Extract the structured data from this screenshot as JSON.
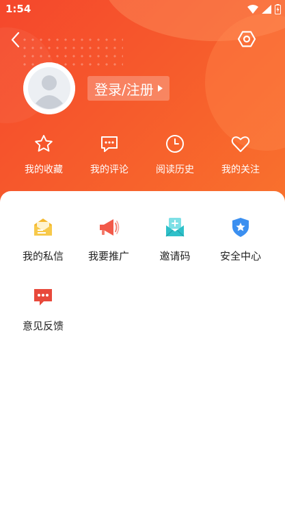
{
  "status_bar": {
    "time": "1:54"
  },
  "header": {
    "login_label": "登录/注册"
  },
  "quick_actions": [
    {
      "label": "我的收藏",
      "icon": "star-icon"
    },
    {
      "label": "我的评论",
      "icon": "comment-icon"
    },
    {
      "label": "阅读历史",
      "icon": "clock-icon"
    },
    {
      "label": "我的关注",
      "icon": "heart-icon"
    }
  ],
  "services": [
    {
      "label": "我的私信",
      "icon": "mail-icon",
      "color": "#f5b82e"
    },
    {
      "label": "我要推广",
      "icon": "megaphone-icon",
      "color": "#f25a4a"
    },
    {
      "label": "邀请码",
      "icon": "invite-icon",
      "color": "#2ec0c9"
    },
    {
      "label": "安全中心",
      "icon": "shield-icon",
      "color": "#3b8ff0"
    },
    {
      "label": "意见反馈",
      "icon": "feedback-icon",
      "color": "#e8493b"
    }
  ],
  "colors": {
    "hero_start": "#f5472c",
    "hero_end": "#f9722d"
  }
}
